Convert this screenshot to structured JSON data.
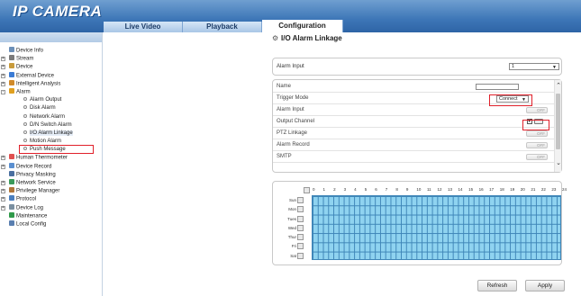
{
  "app": {
    "logo": "IP CAMERA"
  },
  "tabs": [
    {
      "label": "Live Video",
      "active": false
    },
    {
      "label": "Playback",
      "active": false
    },
    {
      "label": "Configuration",
      "active": true
    }
  ],
  "page": {
    "title": "I/O Alarm Linkage"
  },
  "sidebar": {
    "items": [
      {
        "label": "Device Info",
        "level": 1,
        "expander": "",
        "icon": "info-icon"
      },
      {
        "label": "Stream",
        "level": 1,
        "expander": "+",
        "icon": "stream-icon"
      },
      {
        "label": "Device",
        "level": 1,
        "expander": "+",
        "icon": "device-icon"
      },
      {
        "label": "External Device",
        "level": 1,
        "expander": "+",
        "icon": "external-device-icon"
      },
      {
        "label": "Intelligent Analysis",
        "level": 1,
        "expander": "+",
        "icon": "analysis-icon"
      },
      {
        "label": "Alarm",
        "level": 1,
        "expander": "-",
        "icon": "alarm-icon"
      },
      {
        "label": "Alarm Output",
        "level": 2
      },
      {
        "label": "Disk Alarm",
        "level": 2
      },
      {
        "label": "Network Alarm",
        "level": 2
      },
      {
        "label": "D/N Switch Alarm",
        "level": 2
      },
      {
        "label": "I/O Alarm Linkage",
        "level": 2,
        "selected": true
      },
      {
        "label": "Motion Alarm",
        "level": 2
      },
      {
        "label": "Push Message",
        "level": 2
      },
      {
        "label": "Human Thermometer",
        "level": 1,
        "expander": "+",
        "icon": "thermometer-icon"
      },
      {
        "label": "Device Record",
        "level": 1,
        "expander": "+",
        "icon": "record-icon"
      },
      {
        "label": "Privacy Masking",
        "level": 1,
        "expander": "",
        "icon": "privacy-icon"
      },
      {
        "label": "Network Service",
        "level": 1,
        "expander": "+",
        "icon": "network-icon"
      },
      {
        "label": "Privilege Manager",
        "level": 1,
        "expander": "+",
        "icon": "privilege-icon"
      },
      {
        "label": "Protocol",
        "level": 1,
        "expander": "+",
        "icon": "protocol-icon"
      },
      {
        "label": "Device Log",
        "level": 1,
        "expander": "+",
        "icon": "log-icon"
      },
      {
        "label": "Maintenance",
        "level": 1,
        "expander": "",
        "icon": "maintenance-icon"
      },
      {
        "label": "Local Config",
        "level": 1,
        "expander": "",
        "icon": "config-icon"
      }
    ]
  },
  "alarm_input_panel": {
    "label": "Alarm Input",
    "value": "1"
  },
  "settings": {
    "name_label": "Name",
    "name_value": "",
    "trigger_mode_label": "Trigger Mode",
    "trigger_mode_value": "Connect",
    "rows": [
      {
        "label": "Alarm Input",
        "toggle": "OFF"
      },
      {
        "label": "Output Channel",
        "toggle": ""
      },
      {
        "label": "PTZ Linkage",
        "toggle": "OFF"
      },
      {
        "label": "Alarm Record",
        "toggle": "OFF"
      },
      {
        "label": "SMTP",
        "toggle": "OFF"
      }
    ]
  },
  "schedule": {
    "hours": [
      "0",
      "1",
      "2",
      "3",
      "4",
      "5",
      "6",
      "7",
      "8",
      "9",
      "10",
      "11",
      "12",
      "13",
      "14",
      "15",
      "16",
      "17",
      "18",
      "19",
      "20",
      "21",
      "22",
      "23",
      "24"
    ],
    "days": [
      "Sun",
      "Mon",
      "Tues",
      "Wed",
      "Thur",
      "Fri",
      "Sat"
    ]
  },
  "buttons": {
    "refresh": "Refresh",
    "apply": "Apply"
  },
  "colors": {
    "header": "#3d76b7",
    "schedule_fill": "#8fd3f0",
    "grid_line": "#3f86b8",
    "highlight": "#e0202a"
  }
}
